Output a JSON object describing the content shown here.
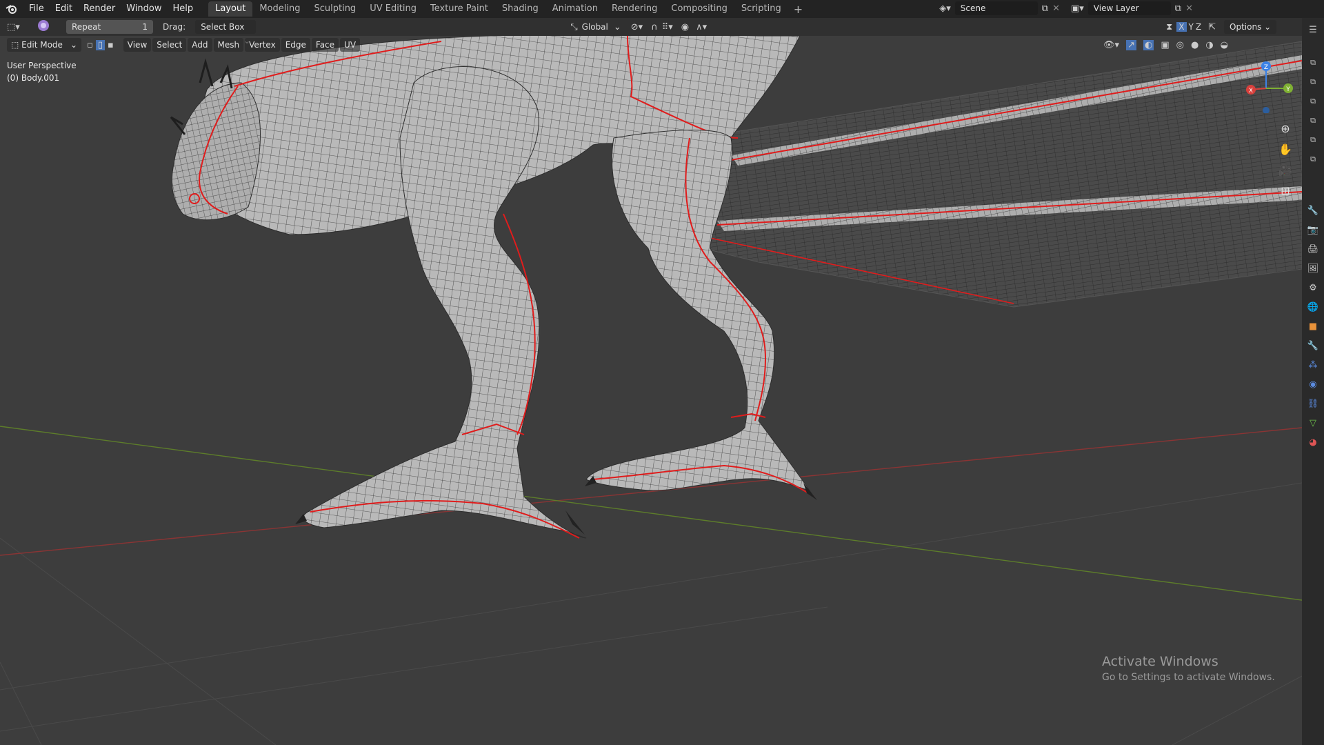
{
  "menu": [
    "File",
    "Edit",
    "Render",
    "Window",
    "Help"
  ],
  "workspaces": [
    "Layout",
    "Modeling",
    "Sculpting",
    "UV Editing",
    "Texture Paint",
    "Shading",
    "Animation",
    "Rendering",
    "Compositing",
    "Scripting"
  ],
  "active_workspace": "Layout",
  "scene": {
    "label": "Scene",
    "view_layer": "View Layer"
  },
  "toolbar": {
    "repeat_label": "Repeat",
    "repeat_count": "1",
    "drag_label": "Drag:",
    "drag_value": "Select Box",
    "transform_orientation": "Global",
    "options_label": "Options",
    "axis_x": "X",
    "axis_y": "Y",
    "axis_z": "Z"
  },
  "header": {
    "mode": "Edit Mode",
    "menus": [
      "View",
      "Select",
      "Add",
      "Mesh",
      "Vertex",
      "Edge",
      "Face",
      "UV"
    ]
  },
  "viewport": {
    "perspective": "User Perspective",
    "object": "(0) Body.001"
  },
  "gizmo": {
    "x": "X",
    "y": "Y",
    "z": "Z"
  },
  "watermark": {
    "title": "Activate Windows",
    "subtitle": "Go to Settings to activate Windows."
  },
  "colors": {
    "seam": "#e01c1c",
    "grid_x": "#a33a3a",
    "grid_y": "#6b8a2e",
    "mesh": "#c9c9c9"
  }
}
